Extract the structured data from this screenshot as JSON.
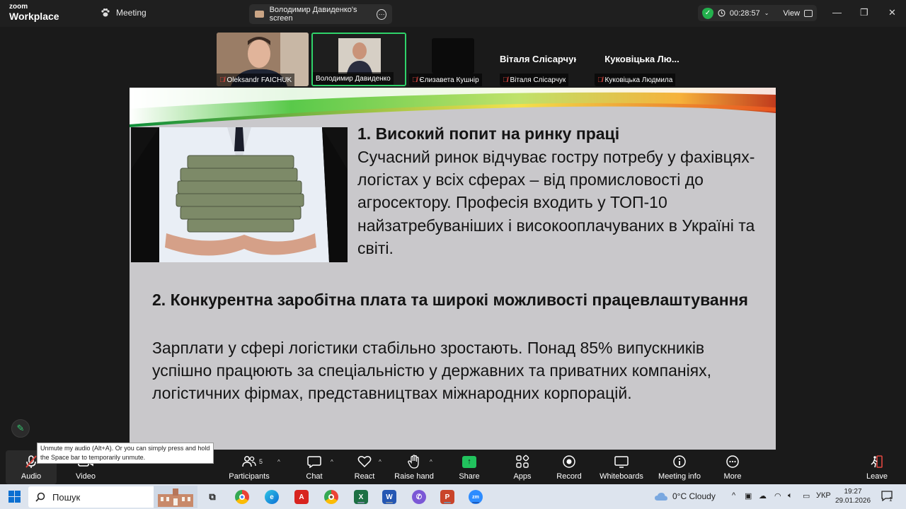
{
  "titlebar": {
    "logo_top": "zoom",
    "logo_bottom": "Workplace",
    "meeting_label": "Meeting",
    "share_tab_label": "Володимир Давиденко's screen",
    "timer": "00:28:57",
    "view_label": "View"
  },
  "participants": [
    {
      "name": "Oleksandr FAICHUK",
      "muted": true,
      "big_name": ""
    },
    {
      "name": "Володимир Давиденко",
      "muted": false,
      "big_name": ""
    },
    {
      "name": "Єлизавета Кушнір",
      "muted": true,
      "big_name": ""
    },
    {
      "name": "Віталя Слісарчук",
      "muted": true,
      "big_name": "Віталя Слісарчук"
    },
    {
      "name": "Куковіцька Людмила",
      "muted": true,
      "big_name": "Куковіцька Лю..."
    }
  ],
  "slide": {
    "s1_head": "1. Високий попит на ринку праці",
    "s1_body": "Сучасний ринок відчуває гостру потребу у фахівцях-логістах у всіх сферах – від промисловості до агросектору. Професія входить у ТОП-10 найзатребуваніших і високооплачуваних в Україні та світі.",
    "s2_head": "2. Конкурентна заробітна плата та широкі можливості працевлаштування",
    "s2_body": "Зарплати у сфері логістики стабільно зростають. Понад 85% випускників успішно працюють за спеціальністю у державних та приватних компаніях, логістичних фірмах, представництвах міжнародних корпорацій."
  },
  "tooltip": "Unmute my audio (Alt+A). Or you can simply press and hold the Space bar to temporarily unmute.",
  "toolbar": {
    "audio": "Audio",
    "video": "Video",
    "participants": "Participants",
    "participants_count": "5",
    "chat": "Chat",
    "react": "React",
    "raise_hand": "Raise hand",
    "share": "Share",
    "apps": "Apps",
    "record": "Record",
    "whiteboards": "Whiteboards",
    "meeting_info": "Meeting info",
    "more": "More",
    "leave": "Leave"
  },
  "taskbar": {
    "search_placeholder": "Пошук",
    "weather": "0°C  Cloudy",
    "lang": "УКР",
    "time": "19:27",
    "date": "29.01.2026",
    "notifications": "1"
  },
  "colors": {
    "accent_green": "#23d160",
    "muted_red": "#e0463f",
    "leave_red": "#e0463f"
  },
  "icons": {
    "meeting": "paw-icon",
    "security": "shield-check-icon",
    "annotate": "pencil-icon"
  }
}
